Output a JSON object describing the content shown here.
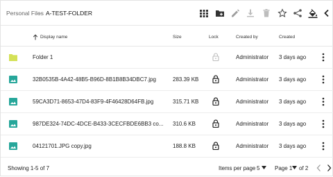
{
  "breadcrumb": {
    "parent": "Personal Files",
    "separator": "›",
    "current": "A-TEST-FOLDER"
  },
  "toolbar": {
    "icons": [
      "grid-view-icon",
      "new-folder-icon",
      "edit-icon",
      "download-icon",
      "delete-icon",
      "favorite-star-icon",
      "share-icon",
      "color-fill-icon",
      "collapse-chevron-icon"
    ]
  },
  "table": {
    "headers": {
      "name": "Display name",
      "size": "Size",
      "lock": "Lock",
      "created_by": "Created by",
      "created": "Created"
    },
    "rows": [
      {
        "type": "folder",
        "name": "Folder 1",
        "size": "",
        "locked": false,
        "created_by": "Administrator",
        "created": "3 days ago"
      },
      {
        "type": "image",
        "name": "32B0535B-4A42-48B5-B96D-8B1B8B34DBC7.jpg",
        "size": "283.39 KB",
        "locked": true,
        "created_by": "Administrator",
        "created": "3 days ago"
      },
      {
        "type": "image",
        "name": "59CA3D71-8653-47D4-83F9-4F46428D64FB.jpg",
        "size": "315.71 KB",
        "locked": true,
        "created_by": "Administrator",
        "created": "3 days ago"
      },
      {
        "type": "image",
        "name": "987DE324-74DC-4DCE-B433-3CECFBDE6BB3 co...",
        "size": "310.6 KB",
        "locked": true,
        "created_by": "Administrator",
        "created": "3 days ago"
      },
      {
        "type": "image",
        "name": "04121701.JPG copy.jpg",
        "size": "188.8 KB",
        "locked": true,
        "created_by": "Administrator",
        "created": "3 days ago"
      }
    ]
  },
  "footer": {
    "showing": "Showing 1-5 of 7",
    "items_per_page_label": "Items per page",
    "items_per_page_value": "5",
    "page_label": "Page 1",
    "of_label": "of 2"
  },
  "colors": {
    "folder": "#d4e157",
    "image": "#26a69a",
    "icon_dark": "#333333",
    "icon_muted": "#bdbdbd"
  }
}
